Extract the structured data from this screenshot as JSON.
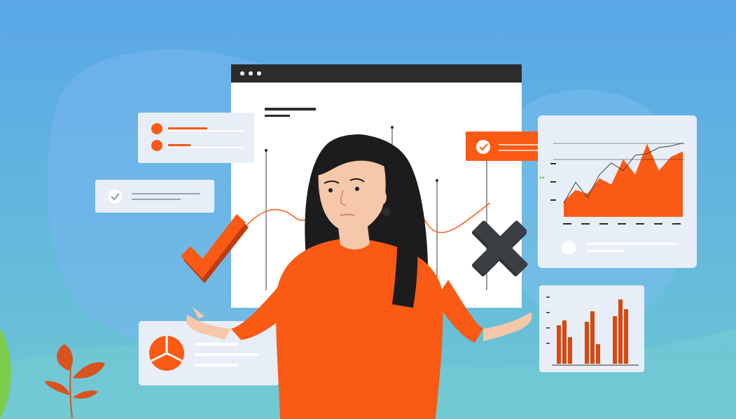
{
  "illustration": {
    "subject": "woman-shrugging-between-check-and-cross",
    "colors": {
      "sky_top": "#5aa6e8",
      "sky_bottom": "#6cc7d3",
      "accent_orange": "#fa5a14",
      "dark_gray": "#3b3f44",
      "card_light": "#e8eef8",
      "window_bar": "#2c2c2c",
      "skin": "#f6c7a8",
      "hair": "#1c1c1e"
    },
    "icons": [
      "browser-window-icon",
      "checkmark-icon",
      "cross-icon",
      "area-chart-icon",
      "bar-chart-icon",
      "pie-chart-icon",
      "list-card-icon",
      "notification-card-icon",
      "plant-icon"
    ]
  },
  "chart_data": [
    {
      "type": "area",
      "series_values": [
        0.2,
        0.35,
        0.3,
        0.5,
        0.42,
        0.75,
        0.55,
        0.95,
        0.6,
        0.78,
        0.85
      ],
      "line_values": [
        0.18,
        0.45,
        0.25,
        0.55,
        0.7,
        0.6,
        0.8,
        0.82,
        0.9,
        0.92,
        0.96
      ]
    },
    {
      "type": "bar",
      "groups": [
        {
          "values": [
            0.55,
            0.62,
            0.38
          ]
        },
        {
          "values": [
            0.6,
            0.75,
            0.28
          ]
        },
        {
          "values": [
            0.68,
            0.92,
            0.78
          ]
        }
      ]
    }
  ]
}
